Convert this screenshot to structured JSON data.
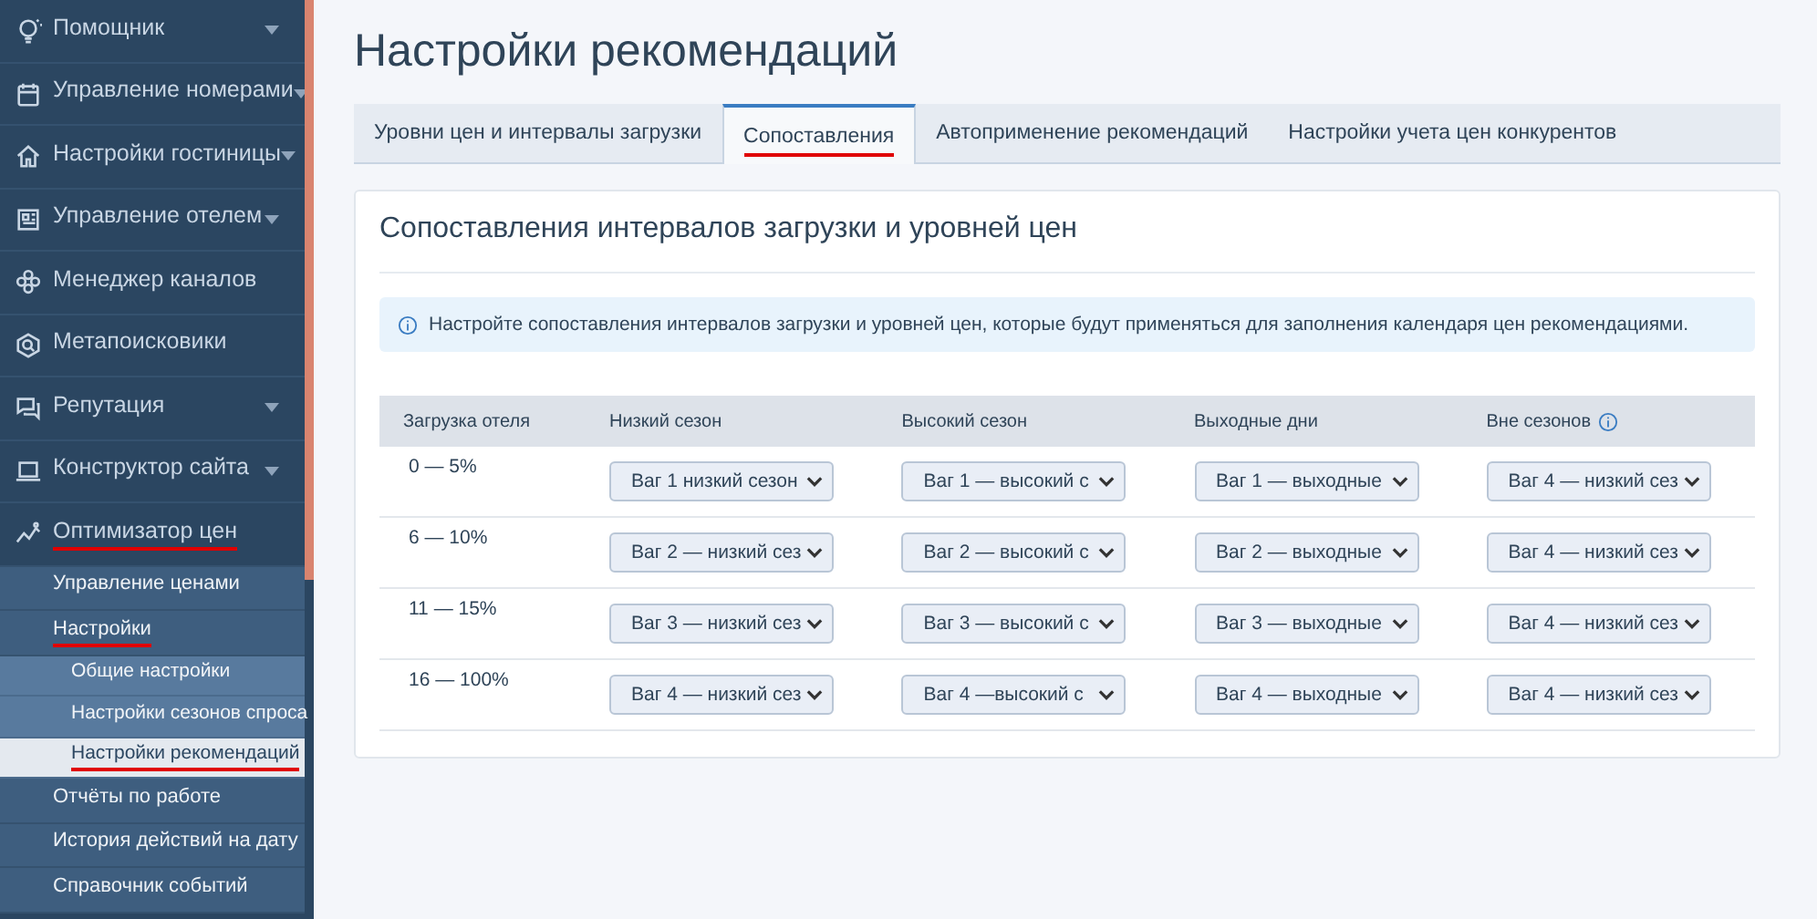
{
  "sidebar": {
    "items": [
      {
        "label": "Помощник",
        "expandable": true,
        "highlighted": false
      },
      {
        "label": "Управление номерами",
        "expandable": true,
        "highlighted": false
      },
      {
        "label": "Настройки гостиницы",
        "expandable": true,
        "highlighted": false
      },
      {
        "label": "Управление отелем",
        "expandable": true,
        "highlighted": false
      },
      {
        "label": "Менеджер каналов",
        "expandable": false,
        "highlighted": false
      },
      {
        "label": "Метапоисковики",
        "expandable": false,
        "highlighted": false
      },
      {
        "label": "Репутация",
        "expandable": true,
        "highlighted": false
      },
      {
        "label": "Конструктор сайта",
        "expandable": true,
        "highlighted": false
      },
      {
        "label": "Оптимизатор цен",
        "expandable": false,
        "highlighted": true,
        "children": [
          {
            "label": "Управление ценами",
            "highlighted": false
          },
          {
            "label": "Настройки",
            "highlighted": true,
            "children": [
              {
                "label": "Общие настройки",
                "selected": false,
                "highlighted": false
              },
              {
                "label": "Настройки сезонов спроса",
                "selected": false,
                "highlighted": false
              },
              {
                "label": "Настройки рекомендаций",
                "selected": true,
                "highlighted": true
              }
            ]
          },
          {
            "label": "Отчёты по работе",
            "highlighted": false
          },
          {
            "label": "История действий на дату",
            "highlighted": false
          },
          {
            "label": "Справочник событий",
            "highlighted": false
          }
        ]
      }
    ]
  },
  "page_title": "Настройки рекомендаций",
  "tabs": [
    {
      "label": "Уровни цен и интервалы загрузки",
      "selected": false,
      "highlighted": false
    },
    {
      "label": "Сопоставления",
      "selected": true,
      "highlighted": true
    },
    {
      "label": "Автоприменение рекомендаций",
      "selected": false,
      "highlighted": false
    },
    {
      "label": "Настройки учета цен конкурентов",
      "selected": false,
      "highlighted": false
    }
  ],
  "panel": {
    "title": "Сопоставления интервалов загрузки и уровней цен",
    "info": "Настройте сопоставления интервалов загрузки и уровней цен, которые будут применяться для заполнения календаря цен рекомендациями.",
    "table": {
      "columns": [
        {
          "label": "Загрузка отеля",
          "info": false
        },
        {
          "label": "Низкий сезон",
          "info": false
        },
        {
          "label": "Высокий сезон",
          "info": false
        },
        {
          "label": "Выходные дни",
          "info": false
        },
        {
          "label": "Вне сезонов",
          "info": true
        }
      ],
      "rows": [
        {
          "load": "0 — 5%",
          "values": [
            "Ваг 1 низкий сезон",
            "Ваг 1 — высокий с",
            "Ваг 1 — выходные",
            "Ваг 4 — низкий сез"
          ]
        },
        {
          "load": "6 — 10%",
          "values": [
            "Ваг 2 — низкий сез",
            "Ваг 2 — высокий с",
            "Ваг 2 — выходные",
            "Ваг 4 — низкий сез"
          ]
        },
        {
          "load": "11 — 15%",
          "values": [
            "Ваг 3 — низкий сез",
            "Ваг 3 — высокий с",
            "Ваг 3 — выходные",
            "Ваг 4 — низкий сез"
          ]
        },
        {
          "load": "16 — 100%",
          "values": [
            "Ваг 4 — низкий сез",
            "Ваг 4 —высокий с",
            "Ваг 4 — выходные",
            "Ваг 4 — низкий сез"
          ]
        }
      ]
    }
  }
}
